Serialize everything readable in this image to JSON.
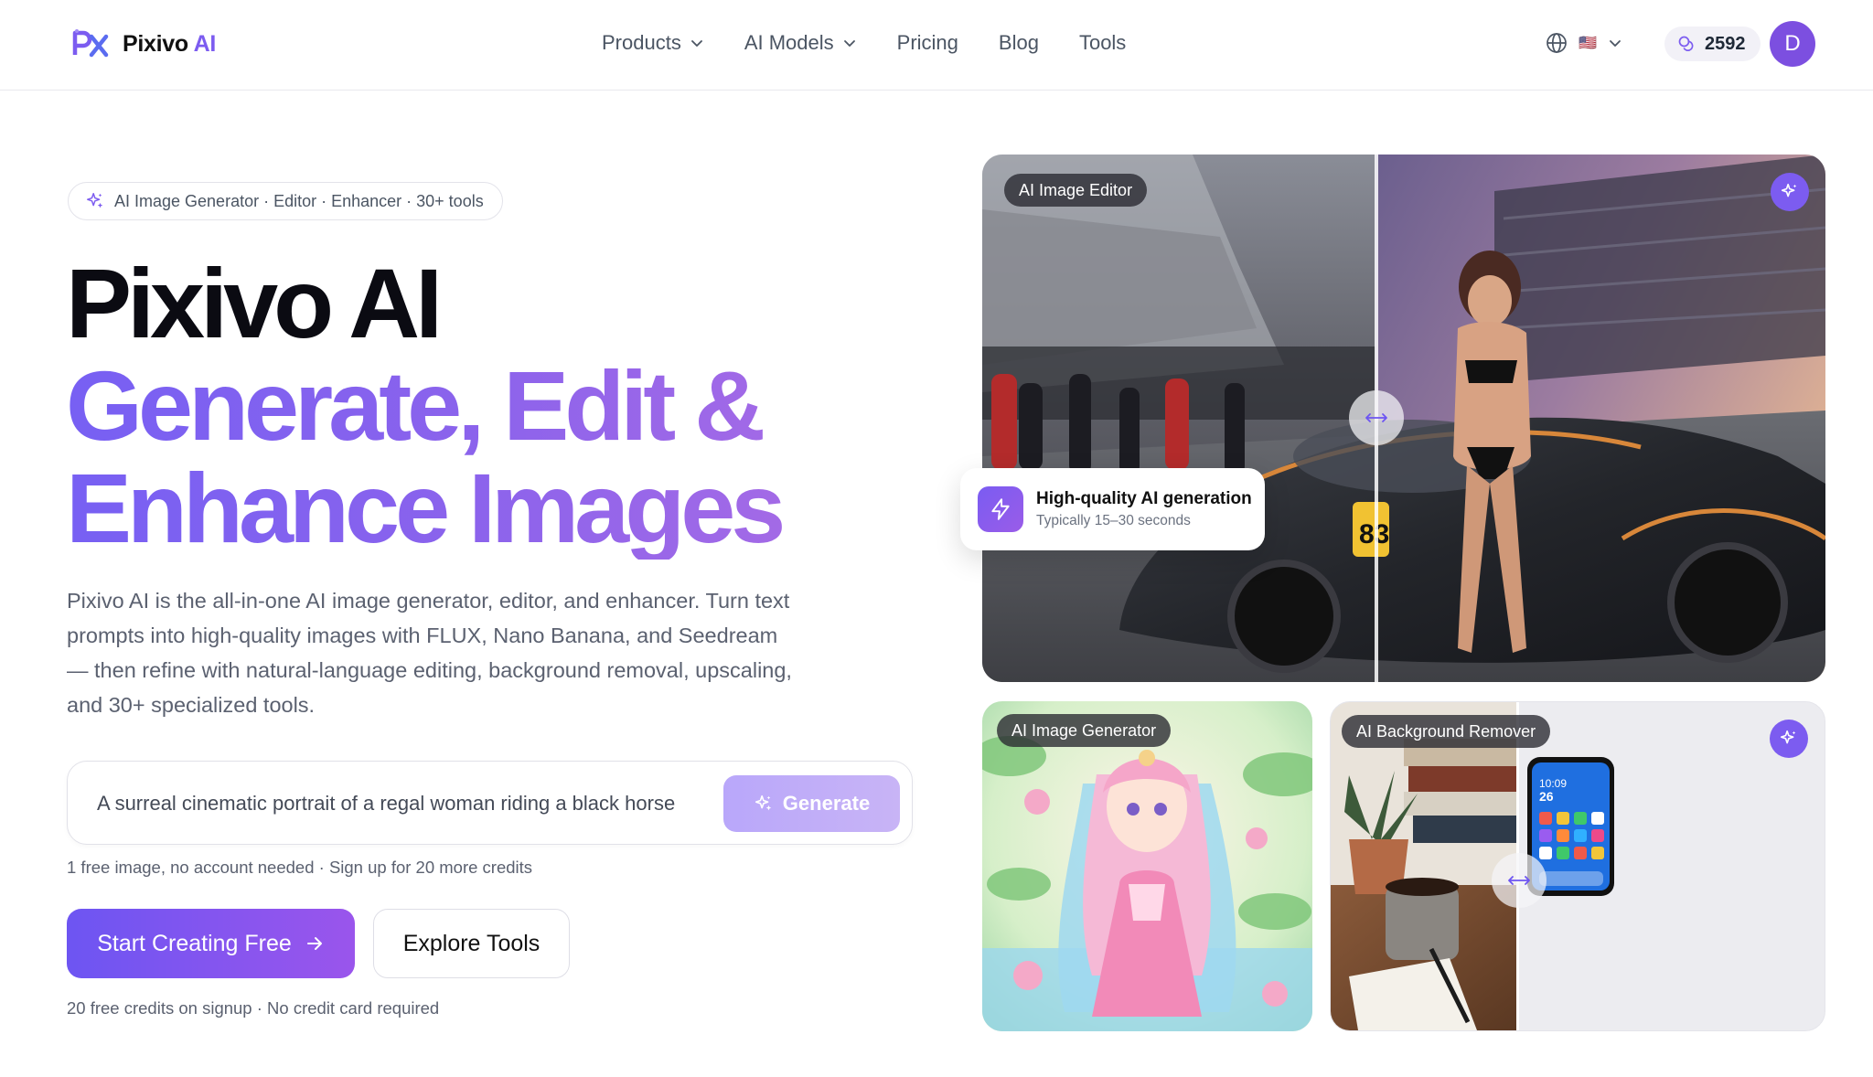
{
  "header": {
    "brand_name": "Pixivo",
    "brand_suffix": "AI",
    "nav": [
      {
        "label": "Products",
        "has_dropdown": true
      },
      {
        "label": "AI Models",
        "has_dropdown": true
      },
      {
        "label": "Pricing",
        "has_dropdown": false
      },
      {
        "label": "Blog",
        "has_dropdown": false
      },
      {
        "label": "Tools",
        "has_dropdown": false
      }
    ],
    "credits": "2592",
    "avatar_initial": "D",
    "flag": "🇺🇸"
  },
  "hero": {
    "pill": "AI Image Generator · Editor · Enhancer · 30+ tools",
    "title": "Pixivo AI",
    "subtitle_line1": "Generate, Edit &",
    "subtitle_line2": "Enhance Images",
    "description": "Pixivo AI is the all-in-one AI image generator, editor, and enhancer. Turn text prompts into high-quality images with FLUX, Nano Banana, and Seedream — then refine with natural-language editing, background removal, upscaling, and 30+ specialized tools.",
    "prompt_value": "A surreal cinematic portrait of a regal woman riding a black horse",
    "generate_label": "Generate",
    "fine_print_1": "1 free image, no account needed · Sign up for 20 more credits",
    "cta_primary": "Start Creating Free",
    "cta_secondary": "Explore Tools",
    "fine_print_2": "20 free credits on signup · No credit card required"
  },
  "gallery": {
    "main_tag": "AI Image Editor",
    "gen_tag": "AI Image Generator",
    "bg_tag": "AI Background Remover",
    "float_title": "High-quality AI generation",
    "float_sub": "Typically 15–30 seconds",
    "phone_time": "10:09",
    "phone_date": "26"
  },
  "colors": {
    "accent": "#7c5cf0",
    "accent_light": "#b9a7fa",
    "text_muted": "#5b6170"
  }
}
